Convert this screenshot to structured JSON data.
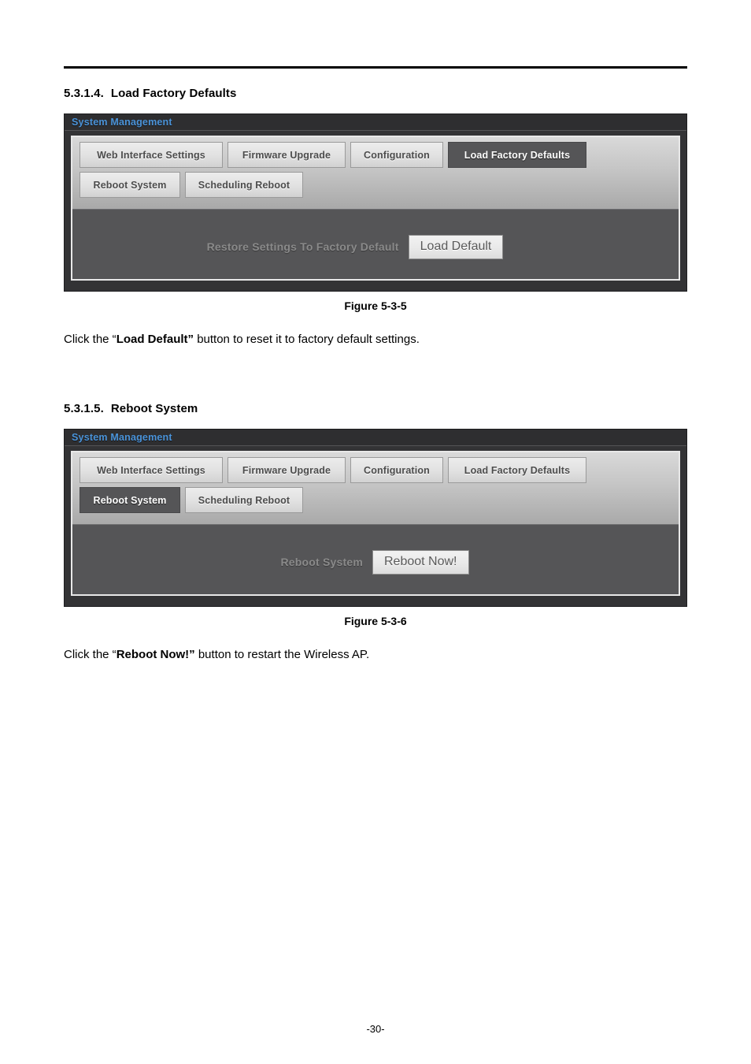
{
  "document": {
    "page_number": "-30-"
  },
  "sections": [
    {
      "number": "5.3.1.4.",
      "title": "Load Factory Defaults",
      "panel": {
        "titlebar": "System Management",
        "tabs_row1": [
          {
            "label": "Web Interface Settings",
            "active": false
          },
          {
            "label": "Firmware Upgrade",
            "active": false
          },
          {
            "label": "Configuration",
            "active": false
          },
          {
            "label": "Load Factory Defaults",
            "active": true
          }
        ],
        "tabs_row2": [
          {
            "label": "Reboot System",
            "active": false
          },
          {
            "label": "Scheduling Reboot",
            "active": false
          }
        ],
        "action_label": "Restore Settings To Factory Default",
        "action_button": "Load Default"
      },
      "caption": "Figure 5-3-5",
      "body": {
        "prefix": "Click the “",
        "bold": "Load Default”",
        "suffix": " button to reset it to factory default settings."
      }
    },
    {
      "number": "5.3.1.5.",
      "title": "Reboot System",
      "panel": {
        "titlebar": "System Management",
        "tabs_row1": [
          {
            "label": "Web Interface Settings",
            "active": false
          },
          {
            "label": "Firmware Upgrade",
            "active": false
          },
          {
            "label": "Configuration",
            "active": false
          },
          {
            "label": "Load Factory Defaults",
            "active": false
          }
        ],
        "tabs_row2": [
          {
            "label": "Reboot System",
            "active": true
          },
          {
            "label": "Scheduling Reboot",
            "active": false
          }
        ],
        "action_label": "Reboot System",
        "action_button": "Reboot Now!"
      },
      "caption": "Figure 5-3-6",
      "body": {
        "prefix": "Click the “",
        "bold": "Reboot Now!”",
        "suffix": " button to restart the Wireless AP."
      }
    }
  ],
  "colors": {
    "panel_frame": "#333335",
    "panel_title_text": "#4a93d9",
    "content_bg": "#555557",
    "active_tab_bg": "#555557",
    "inactive_tab_bg": "#e2e2e2"
  }
}
